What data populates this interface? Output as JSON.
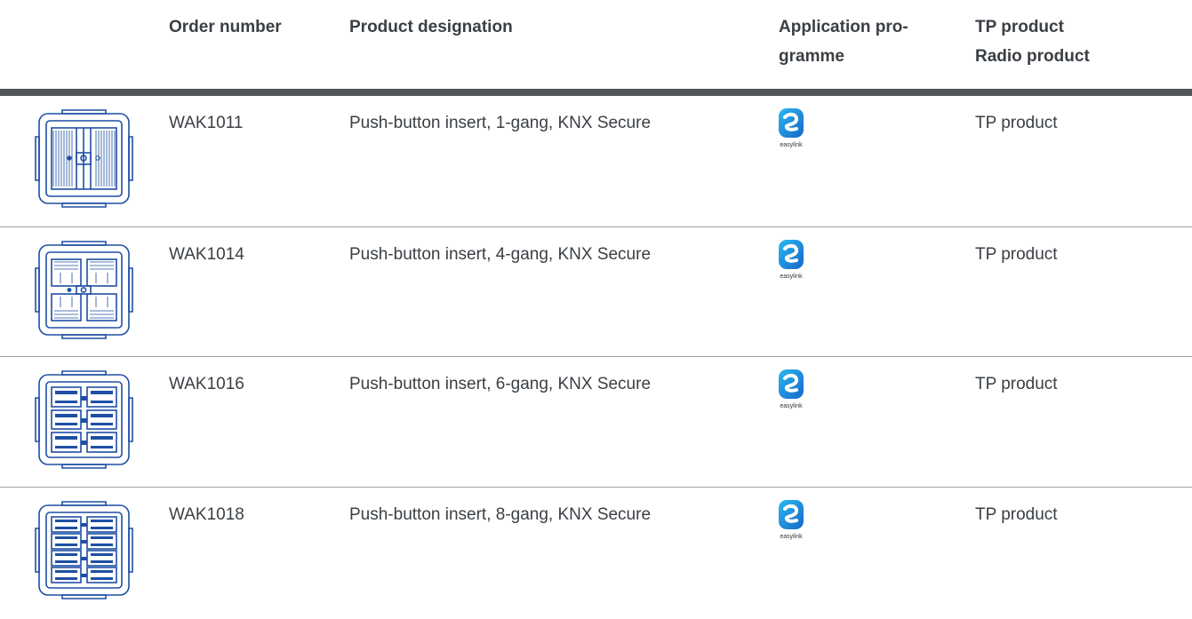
{
  "header": {
    "order_number": "Order number",
    "product_designation": "Product designation",
    "application_programme_line1": "Application pro-",
    "application_programme_line2": "gramme",
    "tp_product": "TP product",
    "radio_product": "Radio product"
  },
  "rows": [
    {
      "order": "WAK1011",
      "designation": "Push-button insert, 1-gang, KNX Secure",
      "app_logo_text": "easylink",
      "tp_radio": "TP product",
      "thumbnail_icon": "push-button-insert-1-gang-icon"
    },
    {
      "order": "WAK1014",
      "designation": "Push-button insert, 4-gang, KNX Secure",
      "app_logo_text": "easylink",
      "tp_radio": "TP product",
      "thumbnail_icon": "push-button-insert-4-gang-icon"
    },
    {
      "order": "WAK1016",
      "designation": "Push-button insert, 6-gang, KNX Secure",
      "app_logo_text": "easylink",
      "tp_radio": "TP product",
      "thumbnail_icon": "push-button-insert-6-gang-icon"
    },
    {
      "order": "WAK1018",
      "designation": "Push-button insert, 8-gang, KNX Secure",
      "app_logo_text": "easylink",
      "tp_radio": "TP product",
      "thumbnail_icon": "push-button-insert-8-gang-icon"
    }
  ],
  "colors": {
    "text": "#3a3f44",
    "rule_thick": "#515559",
    "rule_thin": "#9aa0a6",
    "product_blue": "#1e4fa3",
    "logo_blue": "#1ea0e6"
  }
}
